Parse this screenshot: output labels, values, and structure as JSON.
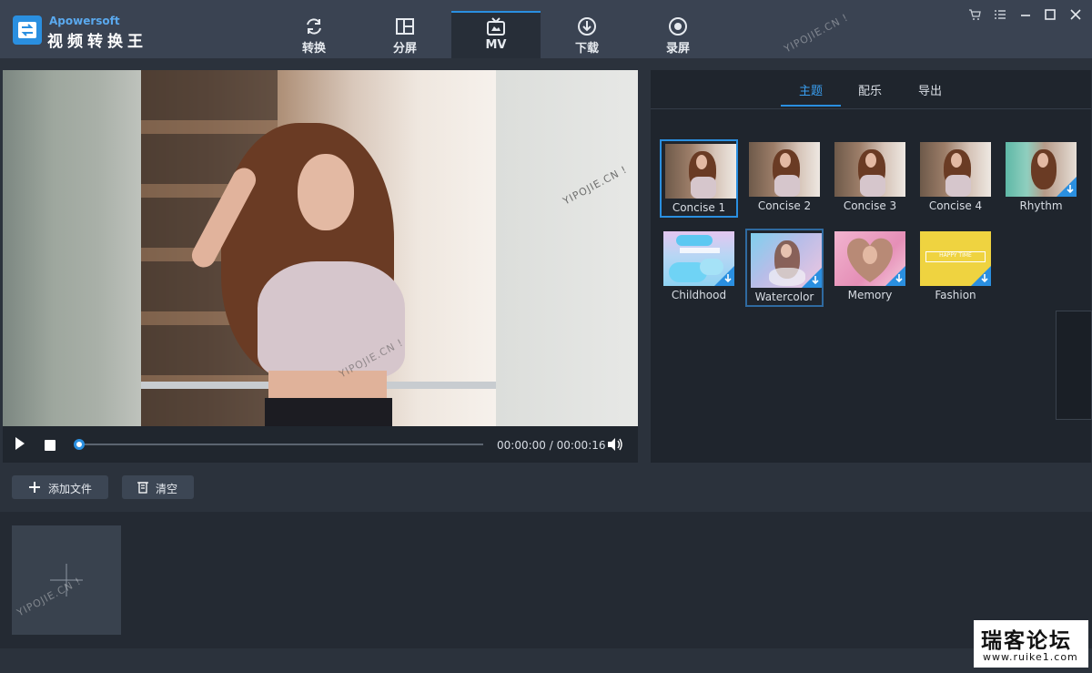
{
  "app": {
    "brand_en": "Apowersoft",
    "brand_cn": "视频转换王",
    "watermark": "YIPOJIE.CN !"
  },
  "nav": {
    "tabs": [
      {
        "label": "转换",
        "icon": "convert-icon"
      },
      {
        "label": "分屏",
        "icon": "split-screen-icon"
      },
      {
        "label": "MV",
        "icon": "mv-tv-icon",
        "active": true
      },
      {
        "label": "下载",
        "icon": "download-icon"
      },
      {
        "label": "录屏",
        "icon": "record-icon"
      }
    ]
  },
  "player": {
    "current_time": "00:00:00",
    "separator": "/",
    "total_time": "00:00:16",
    "progress": 0.0
  },
  "panel": {
    "tabs": [
      {
        "label": "主题",
        "active": true
      },
      {
        "label": "配乐"
      },
      {
        "label": "导出"
      }
    ],
    "themes": [
      {
        "name": "Concise 1",
        "selected": true,
        "download": false
      },
      {
        "name": "Concise 2",
        "download": false
      },
      {
        "name": "Concise 3",
        "download": false
      },
      {
        "name": "Concise 4",
        "download": false
      },
      {
        "name": "Rhythm",
        "download": true
      },
      {
        "name": "Childhood",
        "download": true
      },
      {
        "name": "Watercolor",
        "hover": true,
        "download": true
      },
      {
        "name": "Memory",
        "download": true
      },
      {
        "name": "Fashion",
        "download": true,
        "banner": "HAPPY TIME"
      }
    ]
  },
  "toolbar": {
    "add_file": "添加文件",
    "clear": "清空"
  },
  "corner_badge": {
    "title": "瑞客论坛",
    "url": "www.ruike1.com"
  },
  "colors": {
    "accent": "#2a8fe0",
    "titlebar": "#3a4352",
    "panel": "#1f252d",
    "background": "#2b323c"
  }
}
